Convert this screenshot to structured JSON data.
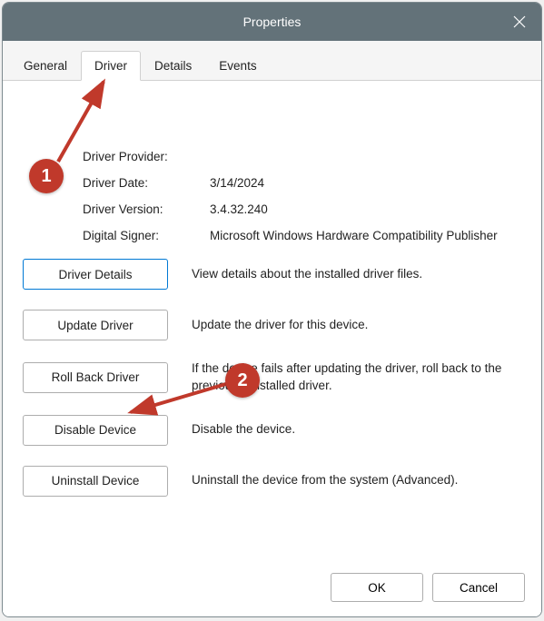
{
  "window": {
    "title": "Properties"
  },
  "tabs": [
    {
      "label": "General",
      "active": false
    },
    {
      "label": "Driver",
      "active": true
    },
    {
      "label": "Details",
      "active": false
    },
    {
      "label": "Events",
      "active": false
    }
  ],
  "driver_info": {
    "provider_label": "Driver Provider:",
    "provider_value": "",
    "date_label": "Driver Date:",
    "date_value": "3/14/2024",
    "version_label": "Driver Version:",
    "version_value": "3.4.32.240",
    "signer_label": "Digital Signer:",
    "signer_value": "Microsoft Windows Hardware Compatibility Publisher"
  },
  "actions": {
    "details": {
      "label": "Driver Details",
      "desc": "View details about the installed driver files."
    },
    "update": {
      "label": "Update Driver",
      "desc": "Update the driver for this device."
    },
    "rollback": {
      "label": "Roll Back Driver",
      "desc": "If the device fails after updating the driver, roll back to the previously installed driver."
    },
    "disable": {
      "label": "Disable Device",
      "desc": "Disable the device."
    },
    "uninstall": {
      "label": "Uninstall Device",
      "desc": "Uninstall the device from the system (Advanced)."
    }
  },
  "footer": {
    "ok": "OK",
    "cancel": "Cancel"
  },
  "annotations": {
    "step1": "1",
    "step2": "2"
  }
}
